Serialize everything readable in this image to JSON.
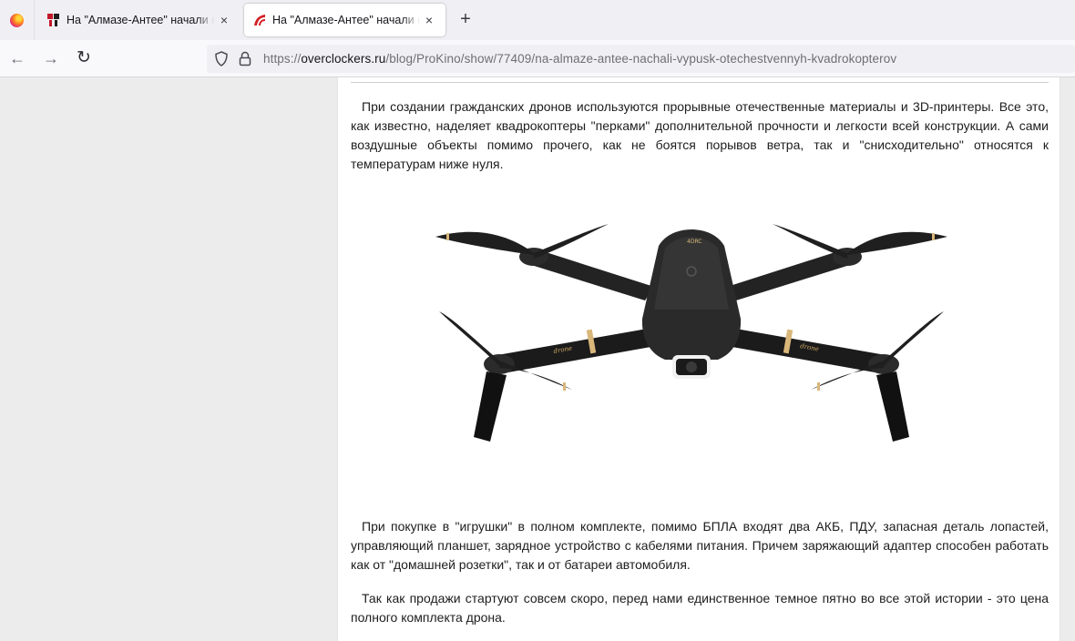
{
  "browser": {
    "tabs": [
      {
        "title": "На \"Алмазе-Антее\" начали выпуск отечественных квадрокоптеров",
        "active": false,
        "favicon": "yandex-favicon"
      },
      {
        "title": "На \"Алмазе-Антее\" начали выпуск отечественных квадрокоптеров",
        "active": true,
        "favicon": "overclockers-favicon"
      }
    ],
    "close_glyph": "×",
    "new_tab_glyph": "+",
    "url": {
      "scheme": "https://",
      "host": "overclockers.ru",
      "path": "/blog/ProKino/show/77409/na-almaze-antee-nachali-vypusk-otechestvennyh-kvadrokopterov"
    }
  },
  "article": {
    "paragraphs": [
      "При создании гражданских дронов используются прорывные отечественные материалы и 3D-принтеры. Все это, как известно, наделяет квадрокоптеры \"перками\" дополнительной прочности и легкости всей конструкции. А сами воздушные объекты помимо прочего, как не боятся порывов ветра, так и \"снисходительно\" относятся к температурам ниже нуля.",
      "При покупке в \"игрушки\" в полном комплекте, помимо БПЛА входят два АКБ, ПДУ, запасная деталь лопастей, управляющий планшет, зарядное устройство с кабелями питания. Причем заряжающий адаптер способен работать как от \"домашней розетки\", так и от батареи автомобиля.",
      "Так как продажи стартуют совсем скоро, перед нами единственное темное пятно во все этой истории - это цена полного комплекта дрона."
    ],
    "image": {
      "subject": "black-foldable-quadcopter-drone",
      "accent": "#d9b77a"
    }
  },
  "colors": {
    "tabbar_bg": "#f0f0f4",
    "urlbar_bg": "#f0f0f4",
    "page_bg": "#ececec",
    "text": "#1d1d1d"
  }
}
